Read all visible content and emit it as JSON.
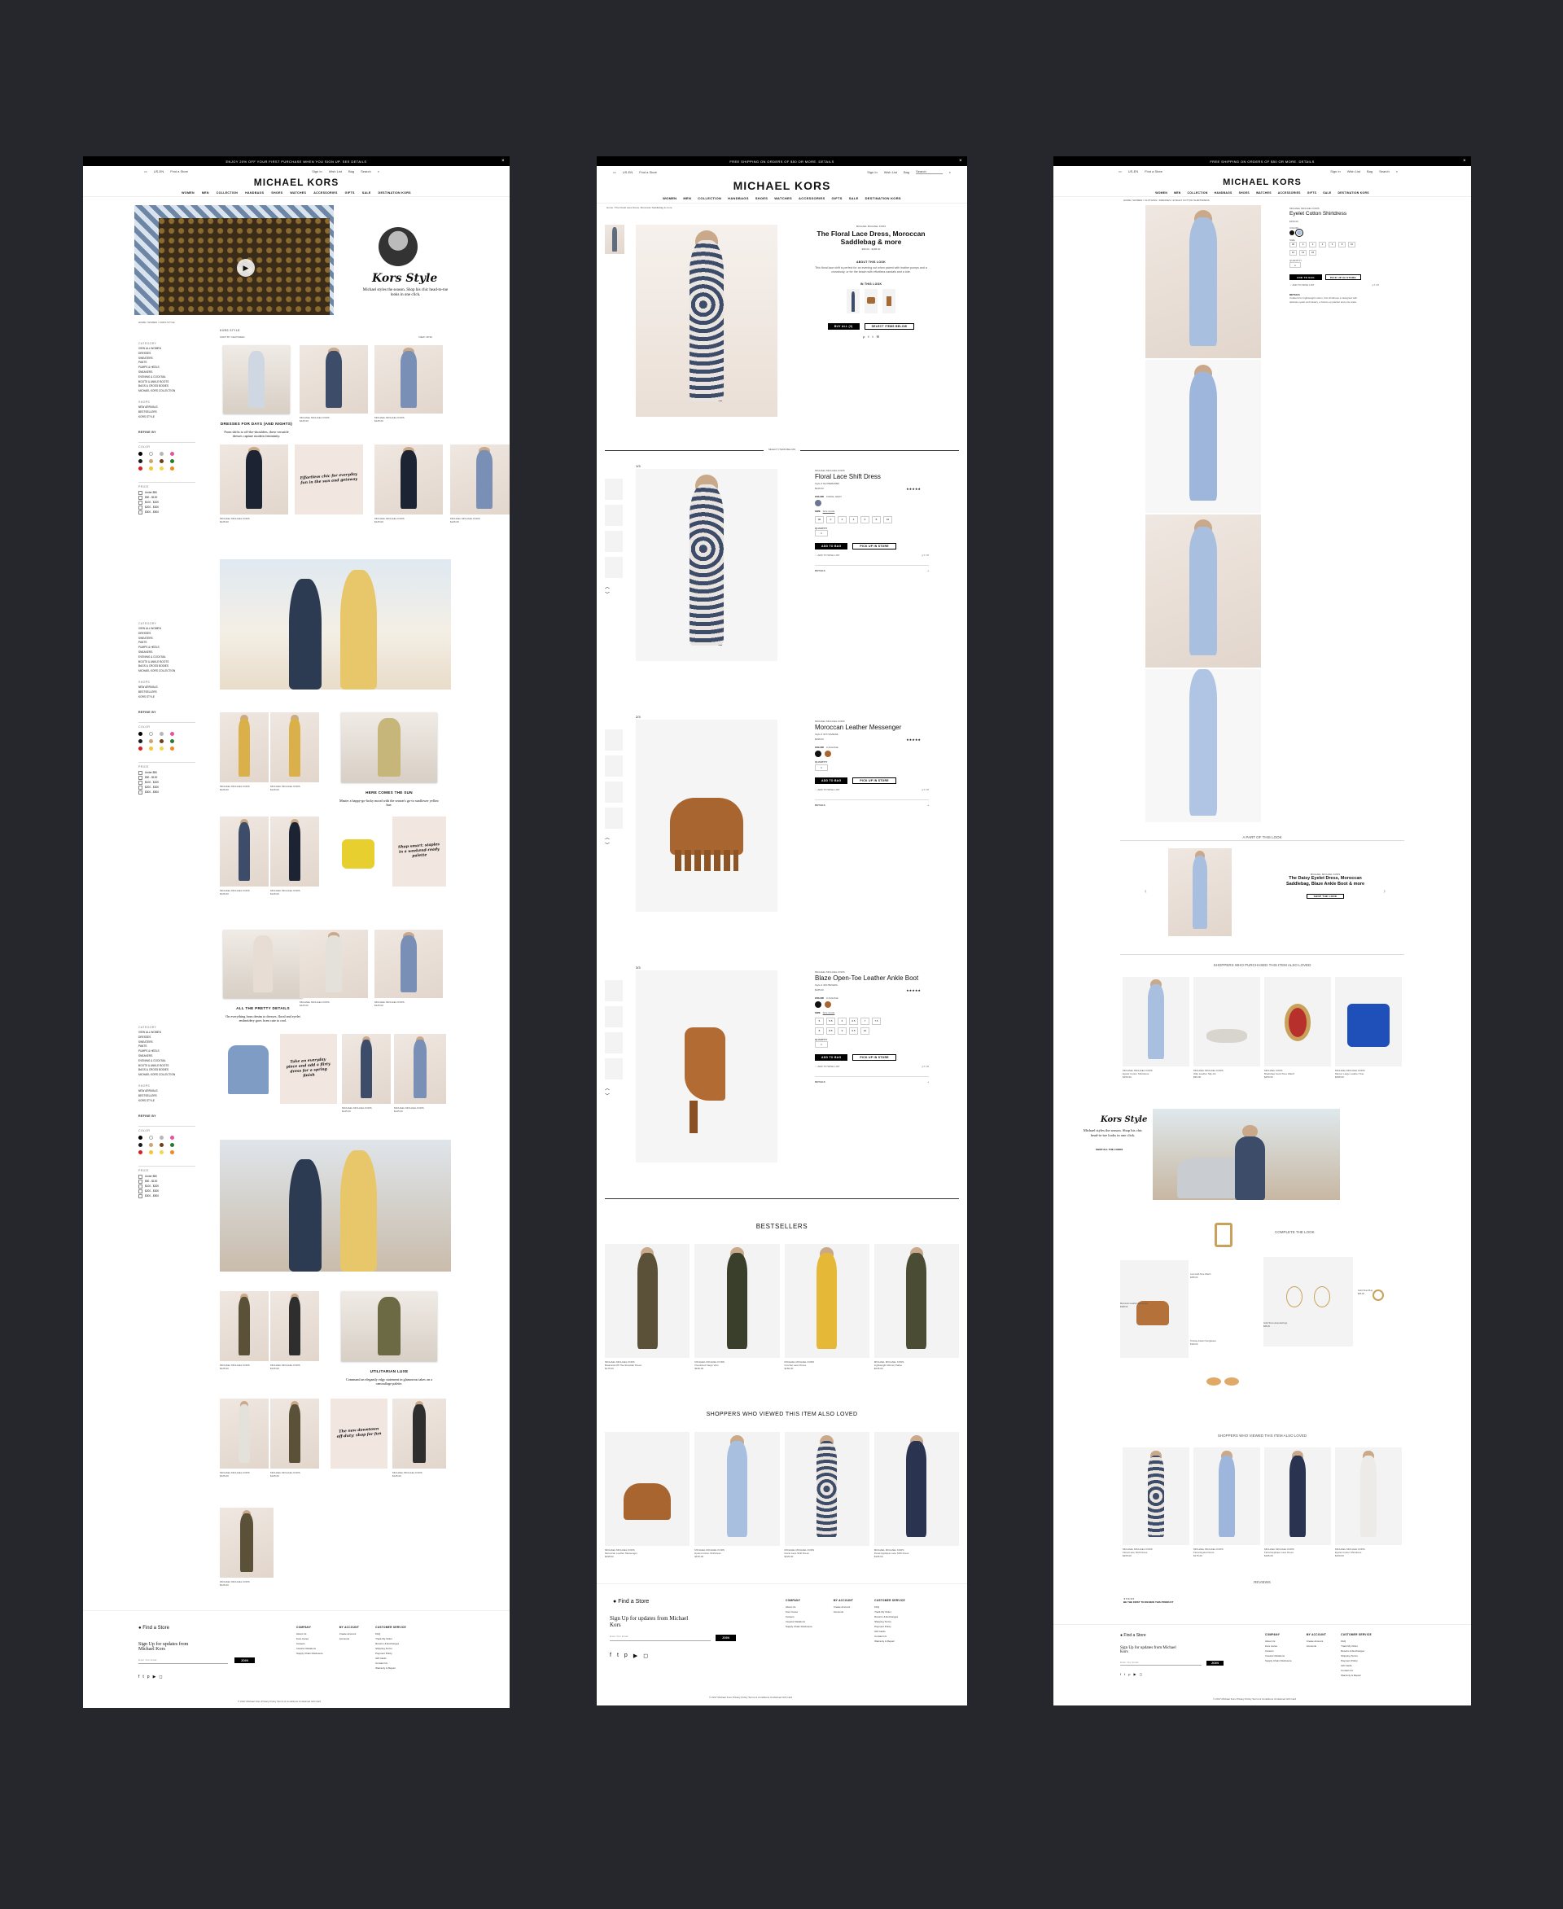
{
  "brand": "MICHAEL KORS",
  "colors": {
    "bg": "#25272c",
    "black": "#000000",
    "tan": "#b5713a",
    "blue": "#a9bfe0"
  },
  "nav": [
    "WOMEN",
    "MEN",
    "COLLECTION",
    "HANDBAGS",
    "SHOES",
    "WATCHES",
    "ACCESSORIES",
    "GIFTS",
    "SALE",
    "DESTINATION KORS"
  ],
  "topbar": {
    "country": "US-EN",
    "store": "Find a Store",
    "signin": "Sign In",
    "wishlist": "Wish List",
    "bag": "Bag",
    "search": "Search"
  },
  "p1": {
    "promo": "ENJOY 20% OFF YOUR FIRST PURCHASE WHEN YOU SIGN UP.  SEE DETAILS",
    "kors_style": "Kors Style",
    "kors_sub": "Michael styles the season. Shop his chic head-to-toe looks in one click.",
    "breadcrumb": "HOME / WOMEN / KORS STYLE",
    "section": "KORS STYLE",
    "sort": "SORT BY: FEATURED",
    "view": "VIEW: 48 96",
    "sidebar": {
      "category": "CATEGORY",
      "items": [
        "VIEW ALL WOMEN",
        "DRESSES",
        "SWEATERS",
        "PANTS",
        "PUMPS & HEELS",
        "SNEAKERS",
        "EVENING & COCKTAIL",
        "BOOTS & ANKLE BOOTS",
        "BAGS & CROSS BODIES",
        "MICHAEL KORS COLLECTION"
      ],
      "shops": "SHOPS",
      "shop_items": [
        "NEW ARRIVALS",
        "BESTSELLERS",
        "KORS STYLE"
      ],
      "refine": "REFINE BY",
      "color": "COLOR",
      "price": "PRICE",
      "prices": [
        "Under $50",
        "$50 - $100",
        "$100 - $200",
        "$200 - $300",
        "$300 - $500"
      ]
    },
    "swatches": [
      "#000000",
      "#ffffff",
      "#b7b7b7",
      "#e8549c",
      "#1a1a1a",
      "#c9a577",
      "#6e3d1a",
      "#2b7a2b",
      "#d8211f",
      "#f3c82b",
      "#f7d44a",
      "#ef8b1e"
    ],
    "stories": [
      {
        "title": "DRESSES FOR DAYS (AND NIGHTS)",
        "text": "From shifts to off-the-shoulders, these versatile dresses capture modern femininity."
      },
      {
        "title": "HERE COMES THE SUN",
        "text": "Master a happy-go-lucky mood with the season's go-to sunflower yellow hue."
      },
      {
        "title": "ALL THE PRETTY DETAILS",
        "text": "On everything from denim to dresses, floral and eyelet embroidery goes from cute to cool."
      },
      {
        "title": "UTILITARIAN LUXE",
        "text": "Command an elegantly edgy statement in glamorous takes on a camouflage palette."
      }
    ],
    "notes": [
      "Effortless chic for everyday fun in the sun and getaway",
      "Shop smart: staples in a weekend-ready palette",
      "Take an everyday piece and add a flirty dress for a spring finish",
      "The new downtown off-duty: shop for fun"
    ],
    "product_brand": "MICHAEL MICHAEL KORS",
    "product_price": "$125.00",
    "footer": {
      "store": "Find a Store",
      "signup": "Sign Up for updates from Michael Kors",
      "email_ph": "Enter Your Email",
      "join": "JOIN",
      "company": "COMPANY",
      "company_items": [
        "About Us",
        "Kors Cares",
        "Careers",
        "Investor Relations",
        "Supply Chain Disclosure"
      ],
      "account": "MY ACCOUNT",
      "account_items": [
        "Create Account",
        "Accounts"
      ],
      "service": "CUSTOMER SERVICE",
      "service_items": [
        "FAQ",
        "Track My Order",
        "Returns & Exchanges",
        "Shipping Terms",
        "Payment Policy",
        "Gift Cards",
        "Contact Us",
        "Warranty & Repair"
      ],
      "legal": "© 2017 Michael Kors   Privacy Policy   Terms & Conditions   Unclaimed Gift Card"
    }
  },
  "p2": {
    "promo": "FREE SHIPPING ON ORDERS OF $50 OR MORE.  DETAILS",
    "breadcrumb": "Home  /  The Floral Lace Dress, Moroccan Saddlebag & more",
    "look_brand": "MICHAEL MICHAEL KORS",
    "look_title": "The Floral Lace Dress, Moroccan Saddlebag & more",
    "look_price": "$90.00 - $298.00",
    "about": "ABOUT THIS LOOK",
    "about_text": "This floral lace shift is perfect for an evening out when paired with leather pumps and a crossbody, or for the beach with effortless sandals and a tote.",
    "in_look": "IN THIS LOOK",
    "buy_all": "BUY ALL (3)",
    "select_items": "SELECT ITEMS BELOW",
    "select_below": "SELECT ITEMS BELOW",
    "items": [
      {
        "step": "1/3",
        "brand": "MICHAEL MICHAEL KORS",
        "name": "Floral Lace Shift Dress",
        "style": "Style # MU78EBA5BR",
        "price": "$225.00",
        "color_label": "COLOR",
        "color_name": "CORAL GRAY",
        "size_label": "SIZE",
        "size_guide": "Size Guide",
        "sizes": [
          "00",
          "0",
          "2",
          "4",
          "6",
          "8",
          "10"
        ],
        "qty": "QUANTITY",
        "qty_val": "1"
      },
      {
        "step": "2/3",
        "brand": "MICHAEL MICHAEL KORS",
        "name": "Moroccan Leather Messenger",
        "style": "Style # 30T7GM9M3L",
        "price": "$298.00",
        "color_label": "COLOR",
        "color_name": "LUGGAGE",
        "qty": "QUANTITY",
        "qty_val": "1"
      },
      {
        "step": "3/3",
        "brand": "MICHAEL MICHAEL KORS",
        "name": "Blaze Open-Toe Leather Ankle Boot",
        "style": "Style # 40S7BZHE5L",
        "price": "$185.00",
        "color_label": "COLOR",
        "color_name": "LUGGAGE",
        "size_label": "SIZE",
        "size_guide": "Size Guide",
        "sizes": [
          "5",
          "5.5",
          "6",
          "6.5",
          "7",
          "7.5",
          "8",
          "8.5",
          "9",
          "9.5",
          "10"
        ],
        "qty": "QUANTITY",
        "qty_val": "1"
      }
    ],
    "add_bag": "ADD TO BAG",
    "pickup": "PICK UP IN STORE",
    "wish": "ADD TO WISH LIST",
    "details": "DETAILS",
    "bestsellers": "BESTSELLERS",
    "best": [
      {
        "brand": "MICHAEL MICHAEL KORS",
        "name": "Botanical Off-The-Shoulder Dress",
        "price": "$175.00"
      },
      {
        "brand": "MICHAEL MICHAEL KORS",
        "name": "Oversized Cargo Vest",
        "price": "$195.00"
      },
      {
        "brand": "MICHAEL MICHAEL KORS",
        "name": "Crochet Lace Dress",
        "price": "$150.00"
      },
      {
        "brand": "MICHAEL MICHAEL KORS",
        "name": "Lightweight Woven Parka",
        "price": "$245.00"
      }
    ],
    "viewed_title": "SHOPPERS WHO VIEWED THIS ITEM ALSO LOVED",
    "viewed": [
      {
        "brand": "MICHAEL MICHAEL KORS",
        "name": "Moroccan Leather Messenger",
        "price": "$298.00"
      },
      {
        "brand": "MICHAEL MICHAEL KORS",
        "name": "Eyelet Cotton Shirtdress",
        "price": "$150.00"
      },
      {
        "brand": "MICHAEL MICHAEL KORS",
        "name": "Floral Lace Shift Dress",
        "price": "$225.00"
      },
      {
        "brand": "MICHAEL MICHAEL KORS",
        "name": "Floral Appliqué Lace Shift Dress",
        "price": "$195.00"
      }
    ],
    "footer": {
      "store": "Find a Store",
      "signup": "Sign Up for updates from Michael Kors",
      "email_ph": "Enter Your Email",
      "join": "JOIN",
      "company": "COMPANY",
      "company_items": [
        "About Us",
        "Kors Cares",
        "Careers",
        "Investor Relations",
        "Supply Chain Disclosure"
      ],
      "account": "MY ACCOUNT",
      "account_items": [
        "Create Account",
        "Accounts"
      ],
      "service": "CUSTOMER SERVICE",
      "service_items": [
        "FAQ",
        "Track My Order",
        "Returns & Exchanges",
        "Shipping Terms",
        "Payment Policy",
        "Gift Cards",
        "Contact Us",
        "Warranty & Repair"
      ],
      "legal": "© 2017 Michael Kors   Privacy Policy   Terms & Conditions   Unclaimed Gift Card"
    }
  },
  "p3": {
    "promo": "FREE SHIPPING ON ORDERS OF $50 OR MORE.  DETAILS",
    "breadcrumb": "HOME / WOMEN / CLOTHING / DRESSES / EYELET COTTON SHIRTDRESS",
    "brand": "MICHAEL MICHAEL KORS",
    "name": "Eyelet Cotton Shirtdress",
    "price": "$150.00",
    "color_label": "COLOR",
    "size_label": "SIZE",
    "sizes": [
      "00",
      "0",
      "2",
      "4",
      "6",
      "8",
      "10",
      "12",
      "14",
      "16"
    ],
    "qty": "QUANTITY",
    "qty_val": "1",
    "add_bag": "ADD TO BAG",
    "pickup": "PICK UP IN STORE",
    "wish": "ADD TO WISH LIST",
    "desc_h": "DETAILS",
    "desc": "Crafted from lightweight cotton, this shirtdress is designed with delicate eyelet embroidery, a button-up placket and a tie waist.",
    "part_of_look": "A PART OF THIS LOOK",
    "look_brand": "MICHAEL MICHAEL KORS",
    "look_title": "The Daisy Eyelet Dress, Moroccan Saddlebag, Blaze Ankle Boot & more",
    "shop_look": "SHOP THE LOOK",
    "purchased_title": "SHOPPERS WHO PURCHASED THIS ITEM ALSO LOVED",
    "purchased": [
      {
        "brand": "MICHAEL MICHAEL KORS",
        "name": "Eyelet Cotton Shirtdress",
        "price": "$150.00"
      },
      {
        "brand": "MICHAEL MICHAEL KORS",
        "name": "Ollie Leather Slip-On",
        "price": "$99.00"
      },
      {
        "brand": "MICHAEL KORS",
        "name": "Bradshaw Gold-Tone Watch",
        "price": "$250.00"
      },
      {
        "brand": "MICHAEL MICHAEL KORS",
        "name": "Mercer Large Leather Tote",
        "price": "$358.00"
      }
    ],
    "kors_style": "Kors Style",
    "kors_sub": "Michael styles the season. Shop his chic head-to-toe looks in one click.",
    "shop_all": "SHOP ALL THE LOOKS",
    "complete": "COMPLETE THE LOOK",
    "complete_items": [
      {
        "name": "Moroccan Leather Messenger",
        "price": "$298.00"
      },
      {
        "name": "Lexi Gold-Tone Watch",
        "price": "$250.00"
      },
      {
        "name": "Gold-Tone Hoop Earrings",
        "price": "$95.00"
      },
      {
        "name": "Tortoise Aviator Sunglasses",
        "price": "$140.00"
      },
      {
        "name": "Gold-Tone Ring",
        "price": "$65.00"
      }
    ],
    "viewed_title": "SHOPPERS WHO VIEWED THIS ITEM ALSO LOVED",
    "viewed": [
      {
        "brand": "MICHAEL MICHAEL KORS",
        "name": "Floral Lace Shift Dress",
        "price": "$225.00"
      },
      {
        "brand": "MICHAEL MICHAEL KORS",
        "name": "Floral Eyelet Dress",
        "price": "$175.00"
      },
      {
        "brand": "MICHAEL MICHAEL KORS",
        "name": "Floral Appliqué Lace Dress",
        "price": "$195.00"
      },
      {
        "brand": "MICHAEL MICHAEL KORS",
        "name": "Eyelet Cotton Shirtdress",
        "price": "$150.00"
      }
    ],
    "reviews": "REVIEWS",
    "review_cta": "BE THE FIRST TO REVIEW THIS PRODUCT",
    "footer": {
      "store": "Find a Store",
      "signup": "Sign Up for updates from Michael Kors",
      "email_ph": "Enter Your Email",
      "join": "JOIN",
      "company": "COMPANY",
      "company_items": [
        "About Us",
        "Kors Cares",
        "Careers",
        "Investor Relations",
        "Supply Chain Disclosure"
      ],
      "account": "MY ACCOUNT",
      "account_items": [
        "Create Account",
        "Accounts"
      ],
      "service": "CUSTOMER SERVICE",
      "service_items": [
        "FAQ",
        "Track My Order",
        "Returns & Exchanges",
        "Shipping Terms",
        "Payment Policy",
        "Gift Cards",
        "Contact Us",
        "Warranty & Repair"
      ],
      "legal": "© 2017 Michael Kors   Privacy Policy   Terms & Conditions   Unclaimed Gift Card"
    }
  }
}
